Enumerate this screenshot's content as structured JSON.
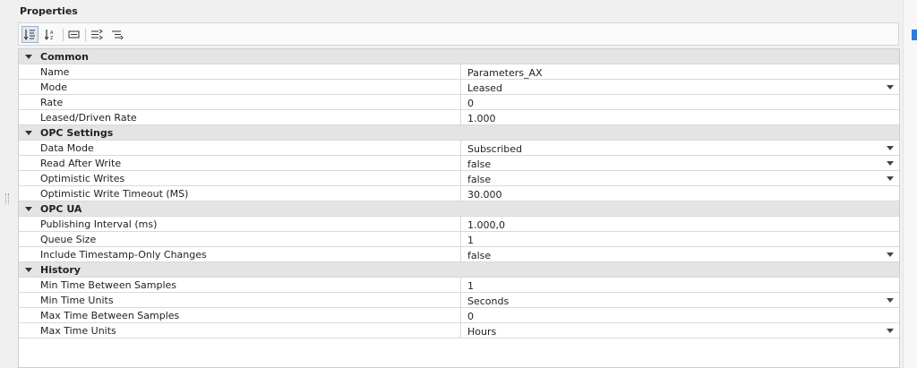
{
  "panel": {
    "title": "Properties"
  },
  "toolbar": {
    "buttons": [
      {
        "icon": "sort-categorized-icon",
        "active": true
      },
      {
        "icon": "sort-alphabetical-icon",
        "active": false
      },
      {
        "icon": "property-pages-icon",
        "active": false
      },
      {
        "icon": "expand-all-icon",
        "active": false
      },
      {
        "icon": "collapse-all-icon",
        "active": false
      }
    ]
  },
  "categories": [
    {
      "label": "Common",
      "properties": [
        {
          "name": "Name",
          "value": "Parameters_AX",
          "dropdown": false
        },
        {
          "name": "Mode",
          "value": "Leased",
          "dropdown": true
        },
        {
          "name": "Rate",
          "value": "0",
          "dropdown": false
        },
        {
          "name": "Leased/Driven Rate",
          "value": "1.000",
          "dropdown": false
        }
      ]
    },
    {
      "label": "OPC Settings",
      "properties": [
        {
          "name": "Data Mode",
          "value": "Subscribed",
          "dropdown": true
        },
        {
          "name": "Read After Write",
          "value": "false",
          "dropdown": true
        },
        {
          "name": "Optimistic Writes",
          "value": "false",
          "dropdown": true
        },
        {
          "name": "Optimistic Write Timeout (MS)",
          "value": "30.000",
          "dropdown": false
        }
      ]
    },
    {
      "label": "OPC UA",
      "properties": [
        {
          "name": "Publishing Interval (ms)",
          "value": "1.000,0",
          "dropdown": false
        },
        {
          "name": "Queue Size",
          "value": "1",
          "dropdown": false
        },
        {
          "name": "Include Timestamp-Only Changes",
          "value": "false",
          "dropdown": true
        }
      ]
    },
    {
      "label": "History",
      "properties": [
        {
          "name": "Min Time Between Samples",
          "value": "1",
          "dropdown": false
        },
        {
          "name": "Min Time Units",
          "value": "Seconds",
          "dropdown": true
        },
        {
          "name": "Max Time Between Samples",
          "value": "0",
          "dropdown": false
        },
        {
          "name": "Max Time Units",
          "value": "Hours",
          "dropdown": true
        }
      ]
    }
  ]
}
